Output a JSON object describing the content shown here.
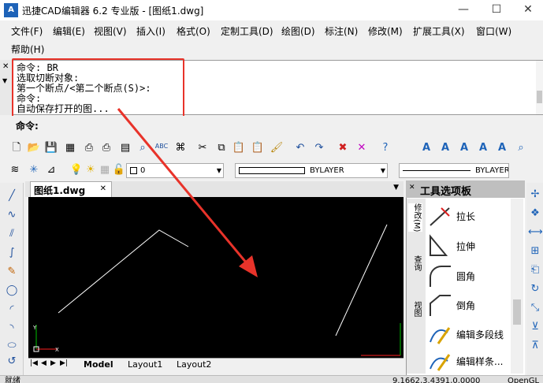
{
  "window": {
    "app_icon_text": "A",
    "title": "迅捷CAD编辑器 6.2 专业版  - [图纸1.dwg]",
    "minimize_glyph": "—",
    "maximize_glyph": "☐",
    "close_glyph": "✕"
  },
  "menu": {
    "items": [
      "文件(F)",
      "编辑(E)",
      "视图(V)",
      "插入(I)",
      "格式(O)",
      "定制工具(D)",
      "绘图(D)",
      "标注(N)",
      "修改(M)",
      "扩展工具(X)",
      "窗口(W)",
      "帮助(H)"
    ]
  },
  "command_history": {
    "lines": [
      "命令:  BR",
      "选取切断对象:",
      "第一个断点/<第二个断点(S)>:",
      "命令:",
      "自动保存打开的图..."
    ]
  },
  "command_prompt": {
    "label": "命令:"
  },
  "toolbar": {
    "layer_value": "0",
    "linetype_value": "BYLAYER",
    "lineweight_value": "BYLAYER"
  },
  "document": {
    "tab_label": "图纸1.dwg",
    "tab_close": "✕"
  },
  "canvas": {
    "ucs_y": "Y",
    "ucs_x": "X",
    "background": "#000000",
    "line_color": "#ffffff"
  },
  "layouts": {
    "tabs": [
      "Model",
      "Layout1",
      "Layout2"
    ]
  },
  "palette": {
    "title": "工具选项板",
    "vtabs": [
      "修改(M)",
      "查询",
      "视图"
    ],
    "items": [
      "拉长",
      "拉伸",
      "圆角",
      "倒角",
      "编辑多段线",
      "编辑样条..."
    ]
  },
  "status": {
    "left": "就绪",
    "coords": "9.1662,3.4391,0.0000",
    "right": "OpenGL"
  },
  "annotation": {
    "color": "#e8332a"
  }
}
